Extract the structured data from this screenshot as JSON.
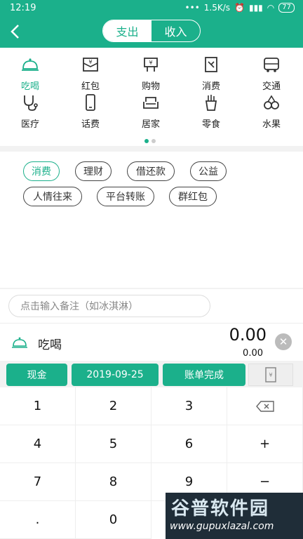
{
  "status_bar": {
    "time": "12:19",
    "speed": "1.5K/s",
    "battery": "77"
  },
  "header": {
    "tabs": [
      {
        "label": "支出"
      },
      {
        "label": "收入"
      }
    ]
  },
  "categories": [
    {
      "label": "吃喝",
      "icon": "food-cloche-icon"
    },
    {
      "label": "红包",
      "icon": "red-envelope-icon"
    },
    {
      "label": "购物",
      "icon": "shopping-icon"
    },
    {
      "label": "消费",
      "icon": "consume-icon"
    },
    {
      "label": "交通",
      "icon": "bus-icon"
    },
    {
      "label": "医疗",
      "icon": "stethoscope-icon"
    },
    {
      "label": "话费",
      "icon": "phone-icon"
    },
    {
      "label": "居家",
      "icon": "sofa-icon"
    },
    {
      "label": "零食",
      "icon": "snack-icon"
    },
    {
      "label": "水果",
      "icon": "fruit-icon"
    }
  ],
  "tags": [
    {
      "label": "消费"
    },
    {
      "label": "理财"
    },
    {
      "label": "借还款"
    },
    {
      "label": "公益"
    },
    {
      "label": "人情往来"
    },
    {
      "label": "平台转账"
    },
    {
      "label": "群红包"
    }
  ],
  "note": {
    "placeholder": "点击输入备注（如冰淇淋）"
  },
  "amount": {
    "category": "吃喝",
    "value": "0.00",
    "sub_value": "0.00"
  },
  "actions": {
    "account": "现金",
    "date": "2019-09-25",
    "done": "账单完成"
  },
  "keypad": {
    "keys": [
      "1",
      "2",
      "3",
      "⌫",
      "4",
      "5",
      "6",
      "+",
      "7",
      "8",
      "9",
      "−",
      ".",
      "0"
    ]
  },
  "watermark": {
    "title": "谷普软件园",
    "url": "www.gupuxlazal.com"
  },
  "colors": {
    "accent": "#1bb08b"
  }
}
